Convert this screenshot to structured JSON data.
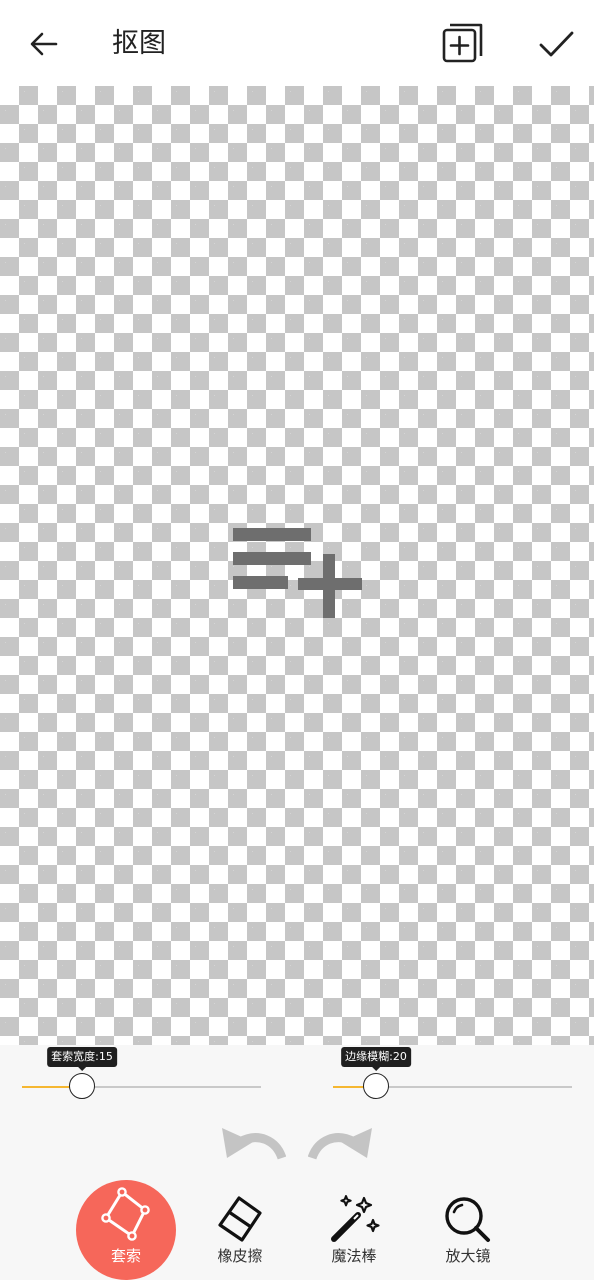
{
  "header": {
    "title": "抠图",
    "back_icon": "arrow-left-icon",
    "add_layer_icon": "add-layer-icon",
    "confirm_icon": "checkmark-icon"
  },
  "canvas": {
    "background": "transparent-checkerboard",
    "placeholder_icon": "add-list-icon"
  },
  "sliders": [
    {
      "label": "套索宽度:15",
      "value": 15,
      "fraction": 0.25
    },
    {
      "label": "边缘模糊:20",
      "value": 20,
      "fraction": 0.18
    }
  ],
  "history": {
    "undo_icon": "undo-icon",
    "redo_icon": "redo-icon"
  },
  "tools": [
    {
      "label": "套索",
      "icon": "lasso-icon",
      "active": true
    },
    {
      "label": "橡皮擦",
      "icon": "eraser-icon",
      "active": false
    },
    {
      "label": "魔法棒",
      "icon": "magic-wand-icon",
      "active": false
    },
    {
      "label": "放大镜",
      "icon": "magnifier-icon",
      "active": false
    }
  ],
  "colors": {
    "accent": "#f5b731",
    "active_tool": "#f6675a",
    "tooltip": "#1f1f1f"
  }
}
